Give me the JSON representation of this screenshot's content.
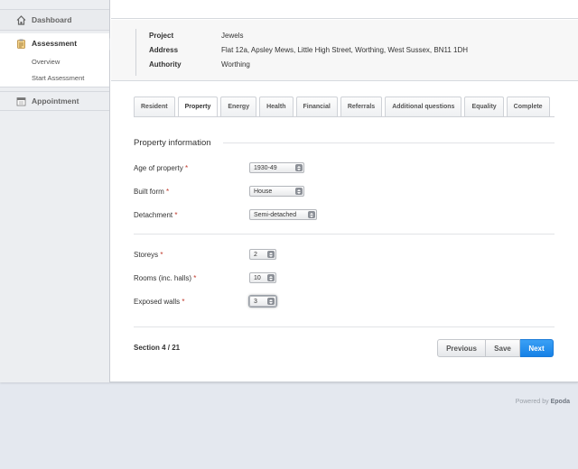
{
  "sidebar": {
    "dashboard": "Dashboard",
    "assessment": "Assessment",
    "sub_items": [
      "Overview",
      "Start Assessment"
    ],
    "appointment": "Appointment",
    "icons": [
      "home-icon",
      "clipboard-icon",
      "calendar-icon"
    ]
  },
  "info": {
    "project_label": "Project",
    "project_value": "Jewels",
    "address_label": "Address",
    "address_value": "Flat 12a, Apsley Mews, Little High Street, Worthing, West Sussex, BN11 1DH",
    "authority_label": "Authority",
    "authority_value": "Worthing"
  },
  "tabs": [
    "Resident",
    "Property",
    "Energy",
    "Health",
    "Financial",
    "Referrals",
    "Additional questions",
    "Equality",
    "Complete"
  ],
  "active_tab": "Property",
  "section_title": "Property information",
  "fields": {
    "age": {
      "label": "Age of property",
      "value": "1930-49"
    },
    "built_form": {
      "label": "Built form",
      "value": "House"
    },
    "detachment": {
      "label": "Detachment",
      "value": "Semi-detached"
    },
    "storeys": {
      "label": "Storeys",
      "value": "2"
    },
    "rooms": {
      "label": "Rooms (inc. halls)",
      "value": "10"
    },
    "exposed_walls": {
      "label": "Exposed walls",
      "value": "3"
    }
  },
  "required_mark": "*",
  "section_count": "Section 4 / 21",
  "buttons": {
    "previous": "Previous",
    "save": "Save",
    "next": "Next"
  },
  "footer": {
    "prefix": "Powered by",
    "brand": "Epoda"
  },
  "colors": {
    "accent": "#1a85ea",
    "required": "#c0392b"
  }
}
